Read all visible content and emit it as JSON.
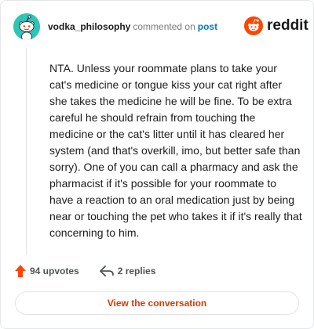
{
  "comment": {
    "username": "vodka_philosophy",
    "action_text": "commented on",
    "post_link": "post",
    "body": "NTA. Unless your roommate plans to take your cat's medicine or tongue kiss your cat right after she takes the medicine he will be fine. To be extra careful he should refrain from touching the medicine or the cat's litter until it has cleared her system (and that's overkill, imo, but better safe than sorry). One of you can call a pharmacy and ask the pharmacist if it's possible for your roommate to have a reaction to an oral medication just by being near or touching the pet who takes it if it's really that concerning to him."
  },
  "brand": {
    "wordmark": "reddit",
    "logo_icon": "reddit-snoo-icon",
    "color": "#ff4500"
  },
  "avatar": {
    "icon": "snoo-avatar-icon",
    "color": "#2ec4b6"
  },
  "stats": {
    "upvotes": "94 upvotes",
    "upvote_icon": "upvote-arrow-icon",
    "replies": "2 replies",
    "reply_icon": "reply-arrow-icon"
  },
  "cta": {
    "label": "View the conversation",
    "color": "#d93a00"
  }
}
